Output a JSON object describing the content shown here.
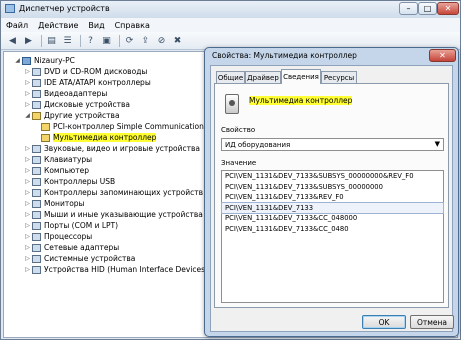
{
  "window": {
    "title": "Диспетчер устройств"
  },
  "menu": [
    "Файл",
    "Действие",
    "Вид",
    "Справка"
  ],
  "toolbar": [
    "back-icon",
    "forward-icon",
    "properties-icon",
    "help-icon",
    "scan-icon",
    "update-driver-icon",
    "disable-icon",
    "uninstall-icon"
  ],
  "tree": {
    "root": "Nizaury-PC",
    "items": [
      {
        "label": "DVD и CD-ROM дисководы",
        "level": 1
      },
      {
        "label": "IDE ATA/ATAPI контроллеры",
        "level": 1
      },
      {
        "label": "Видеоадаптеры",
        "level": 1
      },
      {
        "label": "Дисковые устройства",
        "level": 1
      },
      {
        "label": "Другие устройства",
        "level": 1
      },
      {
        "label": "PCI-контроллер Simple Communications",
        "level": 2
      },
      {
        "label": "Мультимедиа контроллер",
        "level": 2
      },
      {
        "label": "Звуковые, видео и игровые устройства",
        "level": 1
      },
      {
        "label": "Клавиатуры",
        "level": 1
      },
      {
        "label": "Компьютер",
        "level": 1
      },
      {
        "label": "Контроллеры USB",
        "level": 1
      },
      {
        "label": "Контроллеры запоминающих устройств",
        "level": 1
      },
      {
        "label": "Мониторы",
        "level": 1
      },
      {
        "label": "Мыши и иные указывающие устройства",
        "level": 1
      },
      {
        "label": "Порты (COM и LPT)",
        "level": 1
      },
      {
        "label": "Процессоры",
        "level": 1
      },
      {
        "label": "Сетевые адаптеры",
        "level": 1
      },
      {
        "label": "Системные устройства",
        "level": 1
      },
      {
        "label": "Устройства HID (Human Interface Devices)",
        "level": 1
      }
    ]
  },
  "dialog": {
    "title": "Свойства: Мультимедиа контроллер",
    "close": "✕",
    "tabs": [
      "Общие",
      "Драйвер",
      "Сведения",
      "Ресурсы"
    ],
    "active_tab": "Сведения",
    "device_name": "Мультимедиа контроллер",
    "property_label": "Свойство",
    "property_value": "ИД оборудования",
    "value_label": "Значение",
    "values": [
      "PCI\\VEN_1131&DEV_7133&SUBSYS_00000000&REV_F0",
      "PCI\\VEN_1131&DEV_7133&SUBSYS_00000000",
      "PCI\\VEN_1131&DEV_7133&REV_F0",
      "PCI\\VEN_1131&DEV_7133",
      "PCI\\VEN_1131&DEV_7133&CC_048000",
      "PCI\\VEN_1131&DEV_7133&CC_0480"
    ],
    "selected_value_index": 3,
    "ok": "OK",
    "cancel": "Отмена"
  },
  "colors": {
    "highlight": "#ffff33",
    "title_bar": "#cfdcea",
    "dialog_frame": "#c5d6ea"
  }
}
